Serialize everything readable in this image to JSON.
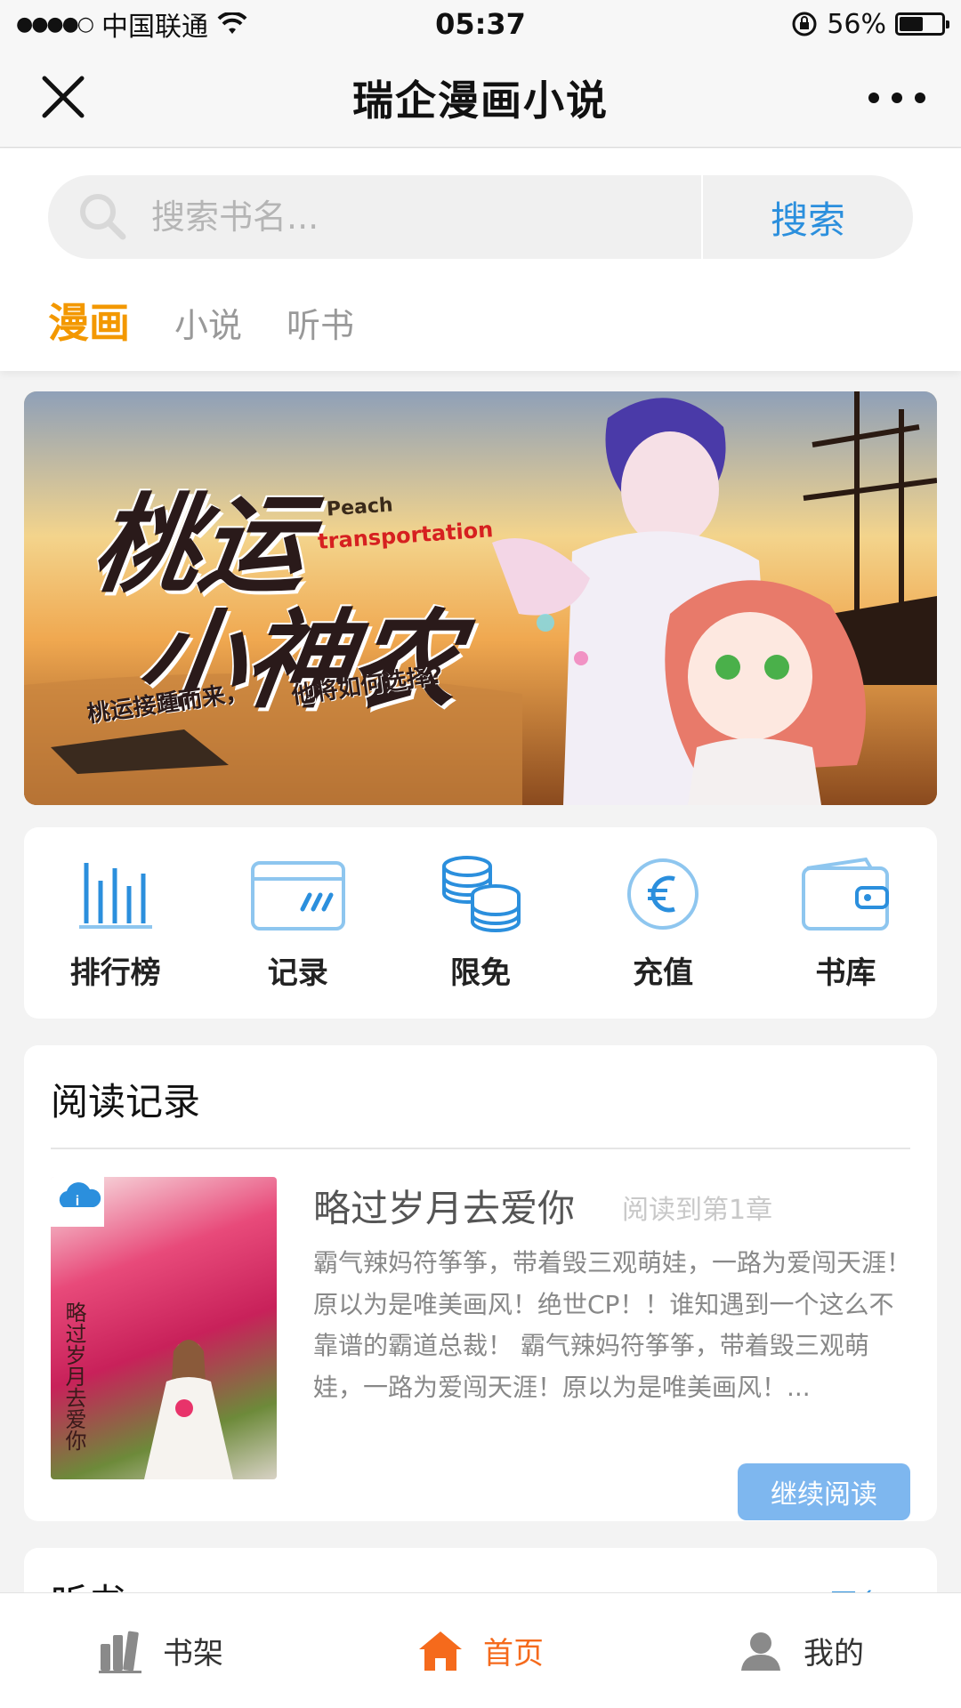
{
  "status_bar": {
    "signal": "●●●●○",
    "carrier": "中国联通",
    "time": "05:37",
    "battery_percent": "56%",
    "battery_level": 0.56
  },
  "nav": {
    "title": "瑞企漫画小说"
  },
  "search": {
    "placeholder": "搜索书名...",
    "button_label": "搜索"
  },
  "tabs": [
    {
      "label": "漫画",
      "active": true
    },
    {
      "label": "小说",
      "active": false
    },
    {
      "label": "听书",
      "active": false
    }
  ],
  "banner": {
    "title_line1": "桃运",
    "title_line2": "小神农",
    "english_line1": "Peach",
    "english_line2": "transportation",
    "slogan_part1": "桃运接踵而来，",
    "slogan_part2": "他将如何选择?"
  },
  "menu": [
    {
      "label": "排行榜",
      "icon": "bar-chart-icon"
    },
    {
      "label": "记录",
      "icon": "card-icon"
    },
    {
      "label": "限免",
      "icon": "coins-icon"
    },
    {
      "label": "充值",
      "icon": "euro-coin-icon"
    },
    {
      "label": "书库",
      "icon": "wallet-icon"
    }
  ],
  "reading_record": {
    "title": "阅读记录",
    "book": {
      "name": "略过岁月去爱你",
      "progress": "阅读到第1章",
      "cover_text": "略过岁月去爱你",
      "description": "霸气辣妈符筝筝，带着毁三观萌娃，一路为爱闯天涯！原以为是唯美画风！绝世CP！！谁知遇到一个这么不靠谱的霸道总裁！ 霸气辣妈符筝筝，带着毁三观萌娃，一路为爱闯天涯！原以为是唯美画风！...",
      "continue_label": "继续阅读"
    }
  },
  "listen_section": {
    "title": "听书",
    "more_label": "更多"
  },
  "tab_bar": [
    {
      "label": "书架",
      "icon": "bookshelf-icon",
      "active": false
    },
    {
      "label": "首页",
      "icon": "home-icon",
      "active": true
    },
    {
      "label": "我的",
      "icon": "user-icon",
      "active": false
    }
  ],
  "colors": {
    "accent_orange": "#f39800",
    "link_blue": "#2b8fdd",
    "icon_blue": "#2b8fdd",
    "home_active": "#f56a1c",
    "button_blue": "#7eb7ef"
  }
}
